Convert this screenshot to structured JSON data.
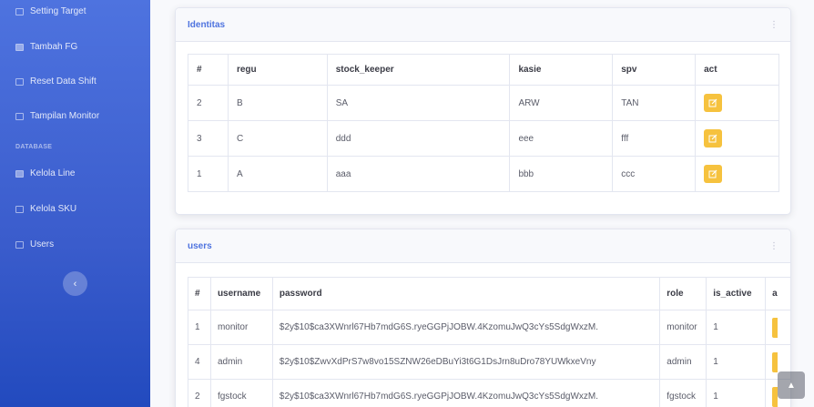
{
  "sidebar": {
    "items": [
      {
        "label": "Setting Target",
        "icon": "target-icon"
      },
      {
        "label": "Tambah FG",
        "icon": "file-icon"
      },
      {
        "label": "Reset Data Shift",
        "icon": "table-icon"
      },
      {
        "label": "Tampilan Monitor",
        "icon": "monitor-icon"
      },
      {
        "label": "Kelola Line",
        "icon": "folder-icon"
      },
      {
        "label": "Kelola SKU",
        "icon": "folder-open-icon"
      },
      {
        "label": "Users",
        "icon": "user-icon"
      }
    ],
    "heading_database": "DATABASE",
    "toggle_glyph": "‹"
  },
  "identitas": {
    "title": "Identitas",
    "menu_glyph": "⋮",
    "columns": [
      "#",
      "regu",
      "stock_keeper",
      "kasie",
      "spv",
      "act"
    ],
    "rows": [
      [
        "2",
        "B",
        "SA",
        "ARW",
        "TAN"
      ],
      [
        "3",
        "C",
        "ddd",
        "eee",
        "fff"
      ],
      [
        "1",
        "A",
        "aaa",
        "bbb",
        "ccc"
      ]
    ]
  },
  "users": {
    "title": "users",
    "menu_glyph": "⋮",
    "columns": [
      "#",
      "username",
      "password",
      "role",
      "is_active",
      "a"
    ],
    "rows": [
      [
        "1",
        "monitor",
        "$2y$10$ca3XWnrl67Hb7mdG6S.ryeGGPjJOBW.4KzomuJwQ3cYs5SdgWxzM.",
        "monitor",
        "1"
      ],
      [
        "4",
        "admin",
        "$2y$10$ZwvXdPrS7w8vo15SZNW26eDBuYi3t6G1DsJrn8uDro78YUWkxeVny",
        "admin",
        "1"
      ],
      [
        "2",
        "fgstock",
        "$2y$10$ca3XWnrl67Hb7mdG6S.ryeGGPjJOBW.4KzomuJwQ3cYs5SdgWxzM.",
        "fgstock",
        "1"
      ]
    ]
  },
  "scroll_top_glyph": "▲",
  "colors": {
    "primary": "#4e73df",
    "warning": "#f6c23e"
  }
}
